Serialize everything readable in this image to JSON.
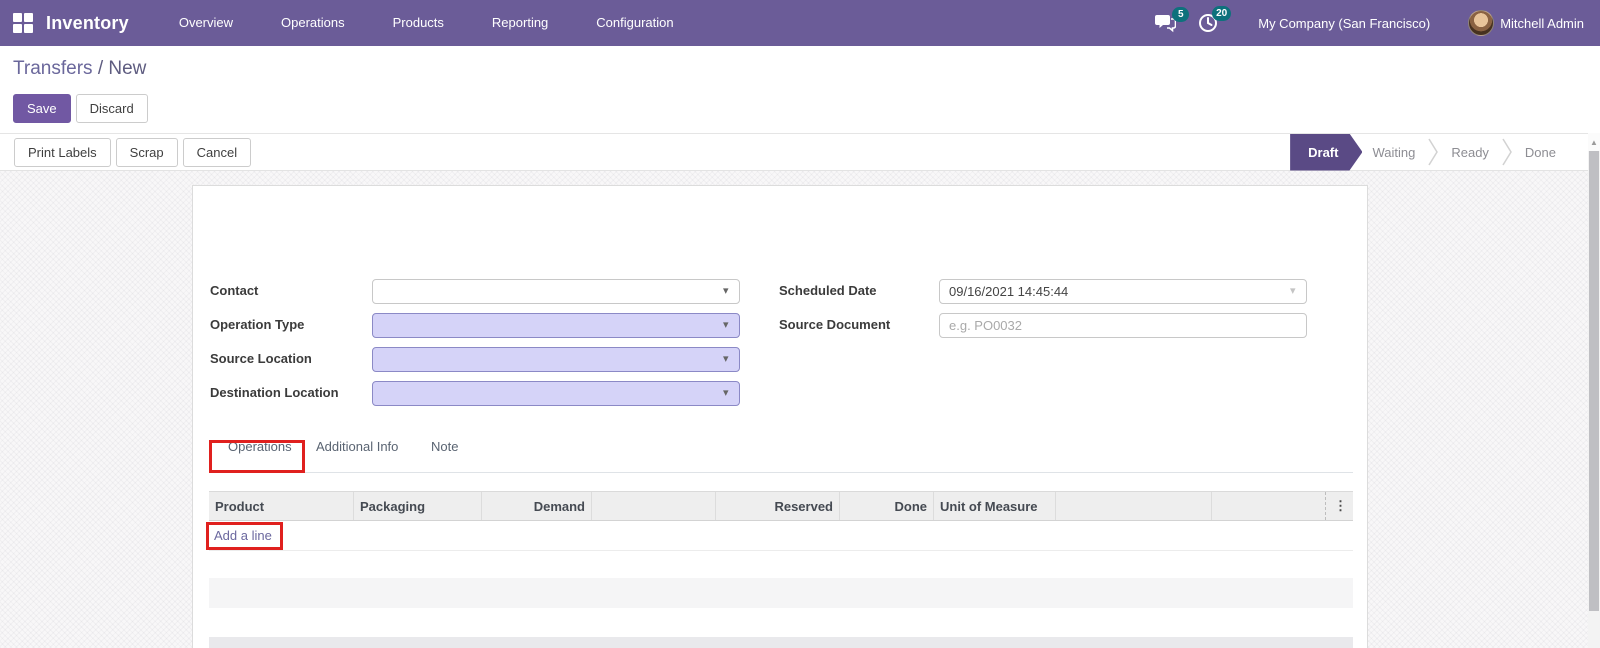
{
  "colors": {
    "navbar": "#6b5c98",
    "primary": "#7158a3",
    "draft": "#5a4a85",
    "lavender": "#d5d3f8",
    "lavender-border": "#8b89c6",
    "badge": "#0e717c",
    "annotation": "#e0201e",
    "link": "#6b689f"
  },
  "nav": {
    "app_name": "Inventory",
    "menus": [
      "Overview",
      "Operations",
      "Products",
      "Reporting",
      "Configuration"
    ],
    "messages_count": "5",
    "activities_count": "20",
    "company": "My Company (San Francisco)",
    "user": "Mitchell Admin"
  },
  "breadcrumb": {
    "parent": "Transfers",
    "separator": " / ",
    "current": "New"
  },
  "actions": {
    "save": "Save",
    "discard": "Discard"
  },
  "toolbar": {
    "print_labels": "Print Labels",
    "scrap": "Scrap",
    "cancel": "Cancel"
  },
  "statusbar": {
    "active_step": "Draft",
    "steps": [
      {
        "label": "Draft"
      },
      {
        "label": "Waiting"
      },
      {
        "label": "Ready"
      },
      {
        "label": "Done"
      }
    ]
  },
  "form": {
    "contact": {
      "label": "Contact",
      "value": ""
    },
    "operation_type": {
      "label": "Operation Type",
      "value": ""
    },
    "source_location": {
      "label": "Source Location",
      "value": ""
    },
    "destination_location": {
      "label": "Destination Location",
      "value": ""
    },
    "scheduled_date": {
      "label": "Scheduled Date",
      "value": "09/16/2021 14:45:44"
    },
    "source_document": {
      "label": "Source Document",
      "placeholder": "e.g. PO0032"
    }
  },
  "tabs": {
    "active": "Operations",
    "items": [
      "Operations",
      "Additional Info",
      "Note"
    ]
  },
  "lines_table": {
    "columns": [
      "Product",
      "Packaging",
      "Demand",
      "",
      "Reserved",
      "Done",
      "Unit of Measure",
      "",
      ""
    ],
    "add_line": "Add a line"
  },
  "icons": {
    "dropdown_caret": "▾",
    "column_options": "⋮",
    "scroll_up": "▲"
  }
}
